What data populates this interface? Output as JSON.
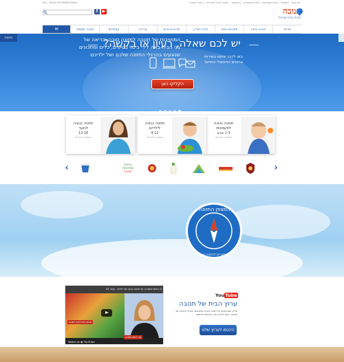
{
  "topbar": {
    "lang": "EN  |  TNUVA INTERNATIONAL",
    "links": [
      "צור קשר",
      "משרות",
      "קשרי משקיעים",
      "אחריות תאגידית",
      "הקבוצה",
      "תנובה חברה ישראלית",
      "אודות החברה"
    ]
  },
  "header": {
    "search_placeholder": "",
    "facebook": "f",
    "youtube": "▶",
    "logo_main": "תנובה",
    "logo_sub": "לגדול בבית ישראלי"
  },
  "nav": {
    "mail_icon": "✉",
    "items": [
      "אודות",
      "תנובה נכונה",
      "מתכונים שלנו",
      "מידע לצרכן",
      "שירות צרכנים",
      "קריירה",
      "קמפיינים",
      "תנובה קוסמטי"
    ]
  },
  "hero": {
    "side_tab": "נגישות",
    "title": "יש לכם שאלה, רעיון או בקשה?",
    "subtitle": "באו לדבר איתנו בשירות צרכנים הדיגיטלי החדש!",
    "button": "הקליקו כאן",
    "dots": 5,
    "active_dot": 4
  },
  "cards": [
    {
      "title": "תזונה נכונה לפעוטות",
      "age": "1-3 שנים",
      "link": "המשיכו לקריאה"
    },
    {
      "title": "תזונה נכונה לילדים",
      "age": "4-12",
      "link": "המשיכו לקריאה"
    },
    {
      "title": "תזונה נכונה לנוער",
      "age": "13-18",
      "link": "המשיכו לקריאה"
    }
  ],
  "brands": {
    "prev": "‹",
    "next": "›",
    "text_brand": "גבינות מחלבות",
    "text_brand_sub": "תנובה"
  },
  "tips": {
    "text": "המחויבות של תנובה לתזונה טובה ובריאה של בני הבית באה לידי ביטוי בטיפים, כלים ומתכונים שנוגעים בהרגלי התזונה שלכם ושל ילדיכם",
    "badge_title": "המצפן התזונתי",
    "badge_sub": "מתחברים לתזונה נכונה"
  },
  "video": {
    "top_title": "5 טיפים לשמירה על תזונה נכונה של ילדים - עופר 10",
    "watch_on": "Watch on ▶ YouTube",
    "caption": "אנחנו מוכרחים לשנות",
    "caption2": "עדי רואת תזונה"
  },
  "youtube": {
    "you": "You",
    "tube": "Tube",
    "title": "ערוץ הבית של תנובה",
    "desc": "מידע ותוכן מגוון על תזונה נכונה ומתכונים בערוץ היוטיוב של תנובה. כנסו לערוץ וגלו סרטונים חדשים",
    "button": "היכנסו לערוץ שלנו"
  },
  "colors": {
    "brand_blue": "#2258a8",
    "brand_red": "#e0401c",
    "hero_blue": "#3a8ae0"
  }
}
